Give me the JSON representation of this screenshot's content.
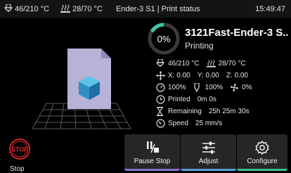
{
  "statusbar": {
    "nozzle_temp": "46/210 °C",
    "bed_temp": "28/70 °C",
    "title": "Ender-3 S1 | Print status",
    "time": "15:49:47",
    "nozzle_icon": "nozzle-icon",
    "bed_icon": "heatbed-icon"
  },
  "job": {
    "progress_label": "0%",
    "progress_fraction": 0.0,
    "file_name": "3121Fast-Ender-3 S...",
    "status": "Printing",
    "nozzle_temp": "46/210 °C",
    "bed_temp": "28/70 °C",
    "x": "X: 0.00",
    "y": "Y: 0.00",
    "z": "Z: 0.00",
    "speed_pct": "100%",
    "flow_pct": "100%",
    "fan_pct": "0%",
    "printed_label": "Printed",
    "printed_value": "0m 0s",
    "remaining_label": "Remaining",
    "remaining_value": "25h 25m 30s",
    "speed_label": "Speed",
    "speed_value": "25 mm/s"
  },
  "controls": {
    "stop_label": "Stop",
    "stop_icon_text": "STOP",
    "pause_label": "Pause Stop",
    "adjust_label": "Adjust",
    "configure_label": "Configure"
  },
  "colors": {
    "accent_green": "#3ec7a6",
    "pause_bar": "#8a72c9",
    "adjust_bar": "#5aa0d8",
    "configure_bar": "#3fbf8f",
    "stop_red": "#e02a2a"
  }
}
